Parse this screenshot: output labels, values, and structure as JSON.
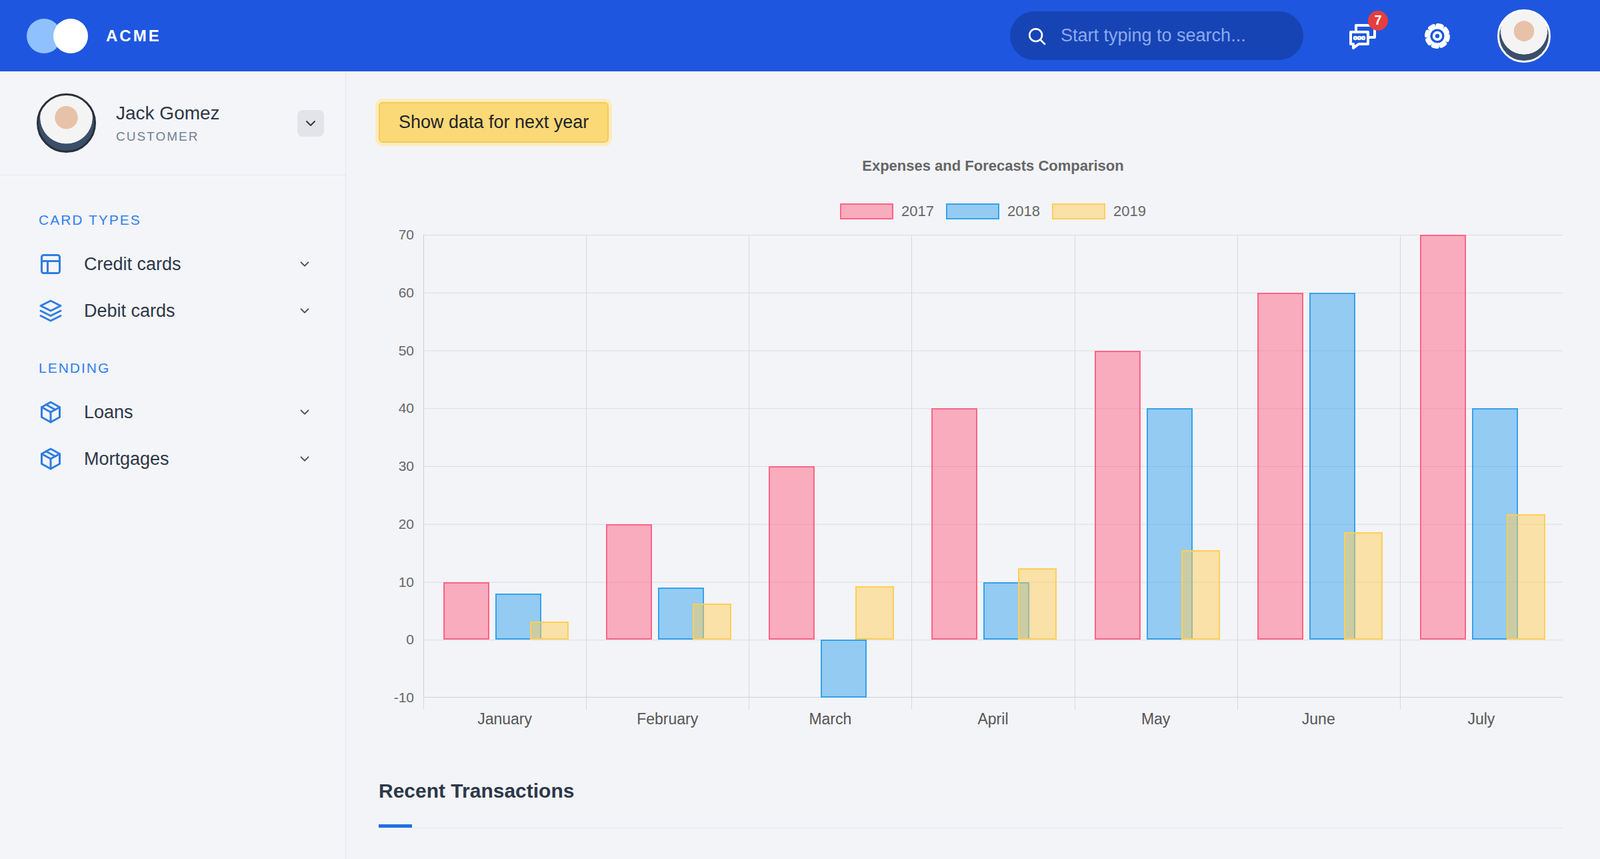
{
  "header": {
    "logo": "ACME",
    "search": {
      "placeholder": "Start typing to search..."
    },
    "messages_badge": "7"
  },
  "user": {
    "name": "Jack Gomez",
    "role": "CUSTOMER"
  },
  "sidebar": {
    "sections": [
      {
        "title": "CARD TYPES",
        "items": [
          {
            "label": "Credit cards",
            "kind": "table",
            "expanded": false
          },
          {
            "label": "Debit cards",
            "kind": "stack",
            "expanded": false
          }
        ]
      },
      {
        "title": "LENDING",
        "items": [
          {
            "label": "Loans",
            "kind": "package",
            "expanded": false
          },
          {
            "label": "Mortgages",
            "kind": "package",
            "expanded": false
          }
        ]
      }
    ]
  },
  "action_button": "Show data for next year",
  "chart": {
    "title": "Expenses and Forecasts Comparison",
    "y_ticks": [
      "70",
      "60",
      "50",
      "40",
      "30",
      "20",
      "10",
      "0",
      "-10"
    ],
    "categories": [
      "January",
      "February",
      "March",
      "April",
      "May",
      "June",
      "July"
    ],
    "series": [
      {
        "name": "2017",
        "color": "#ff6384",
        "values": [
          10,
          20,
          30,
          40,
          50,
          60,
          70
        ]
      },
      {
        "name": "2018",
        "color": "#36a2eb",
        "values": [
          8,
          9,
          -10,
          10,
          40,
          60,
          40
        ]
      },
      {
        "name": "2019",
        "color": "#ffce56",
        "values": [
          3.1,
          6.2,
          9.3,
          12.4,
          15.5,
          18.6,
          21.7
        ]
      }
    ]
  },
  "section": {
    "title": "Recent Transactions"
  }
}
